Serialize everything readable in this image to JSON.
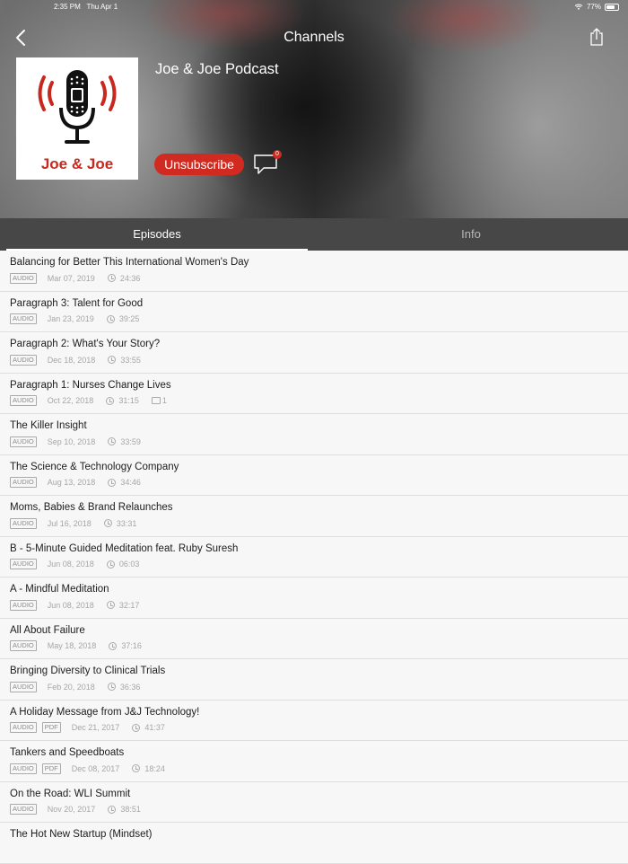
{
  "status_bar": {
    "time": "2:35 PM",
    "date": "Thu Apr 1",
    "battery": "77%",
    "battery_level": 0.77
  },
  "nav": {
    "title": "Channels",
    "back_icon": "chevron-left-icon",
    "share_icon": "share-icon"
  },
  "podcast": {
    "title": "Joe & Joe Podcast",
    "artwork_text": "Joe & Joe",
    "unsubscribe_label": "Unsubscribe",
    "comment_count": "0"
  },
  "tabs": [
    {
      "label": "Episodes",
      "active": true
    },
    {
      "label": "Info",
      "active": false
    }
  ],
  "colors": {
    "accent": "#d12a20",
    "tab_bar": "#474747"
  },
  "episodes": [
    {
      "title": "Balancing for Better This International Women's Day",
      "tags": [
        "AUDIO"
      ],
      "date": "Mar 07, 2019",
      "duration": "24:36",
      "comments": ""
    },
    {
      "title": "Paragraph 3: Talent for Good",
      "tags": [
        "AUDIO"
      ],
      "date": "Jan 23, 2019",
      "duration": "39:25",
      "comments": ""
    },
    {
      "title": "Paragraph 2: What's Your Story?",
      "tags": [
        "AUDIO"
      ],
      "date": "Dec 18, 2018",
      "duration": "33:55",
      "comments": ""
    },
    {
      "title": "Paragraph 1: Nurses Change Lives",
      "tags": [
        "AUDIO"
      ],
      "date": "Oct 22, 2018",
      "duration": "31:15",
      "comments": "1"
    },
    {
      "title": "The Killer Insight",
      "tags": [
        "AUDIO"
      ],
      "date": "Sep 10, 2018",
      "duration": "33:59",
      "comments": ""
    },
    {
      "title": "The Science & Technology Company",
      "tags": [
        "AUDIO"
      ],
      "date": "Aug 13, 2018",
      "duration": "34:46",
      "comments": ""
    },
    {
      "title": "Moms, Babies & Brand Relaunches",
      "tags": [
        "AUDIO"
      ],
      "date": "Jul 16, 2018",
      "duration": "33:31",
      "comments": ""
    },
    {
      "title": "B - 5-Minute Guided Meditation feat. Ruby Suresh",
      "tags": [
        "AUDIO"
      ],
      "date": "Jun 08, 2018",
      "duration": "06:03",
      "comments": ""
    },
    {
      "title": "A - Mindful Meditation",
      "tags": [
        "AUDIO"
      ],
      "date": "Jun 08, 2018",
      "duration": "32:17",
      "comments": ""
    },
    {
      "title": "All About Failure",
      "tags": [
        "AUDIO"
      ],
      "date": "May 18, 2018",
      "duration": "37:16",
      "comments": ""
    },
    {
      "title": "Bringing Diversity to Clinical Trials",
      "tags": [
        "AUDIO"
      ],
      "date": "Feb 20, 2018",
      "duration": "36:36",
      "comments": ""
    },
    {
      "title": "A Holiday Message from J&J Technology!",
      "tags": [
        "AUDIO",
        "PDF"
      ],
      "date": "Dec 21, 2017",
      "duration": "41:37",
      "comments": ""
    },
    {
      "title": "Tankers and Speedboats",
      "tags": [
        "AUDIO",
        "PDF"
      ],
      "date": "Dec 08, 2017",
      "duration": "18:24",
      "comments": ""
    },
    {
      "title": "On the Road: WLI Summit",
      "tags": [
        "AUDIO"
      ],
      "date": "Nov 20, 2017",
      "duration": "38:51",
      "comments": ""
    },
    {
      "title": "The Hot New Startup (Mindset)",
      "tags": [],
      "date": "",
      "duration": "",
      "comments": ""
    }
  ]
}
